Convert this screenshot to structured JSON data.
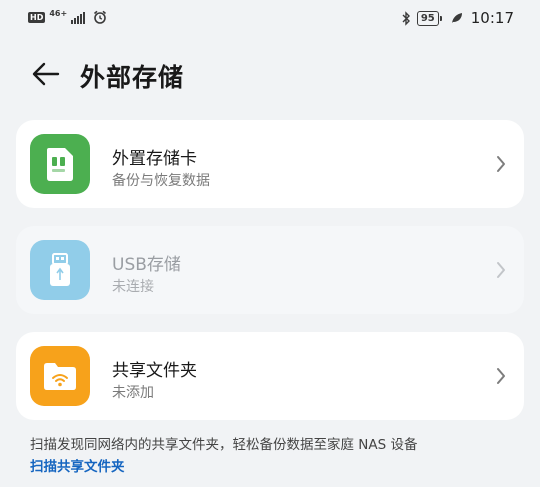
{
  "status_bar": {
    "hd": "HD",
    "network": "46+",
    "battery": "95",
    "time": "10:17",
    "icons": [
      "signal-icon",
      "alarm-icon",
      "bluetooth-icon",
      "battery-icon",
      "leaf-icon"
    ]
  },
  "header": {
    "title": "外部存储",
    "back_icon": "back-arrow-icon"
  },
  "cards": [
    {
      "label": "外置存储卡",
      "sub": "备份与恢复数据",
      "icon": "sd-card-icon",
      "icon_color": "#4caf50",
      "enabled": true
    },
    {
      "label": "USB存储",
      "sub": "未连接",
      "icon": "usb-icon",
      "icon_color": "#91cde9",
      "enabled": false
    },
    {
      "label": "共享文件夹",
      "sub": "未添加",
      "icon": "shared-folder-icon",
      "icon_color": "#f7a21b",
      "enabled": true
    }
  ],
  "footer": {
    "text": "扫描发现同网络内的共享文件夹，轻松备份数据至家庭 NAS 设备",
    "link": "扫描共享文件夹"
  }
}
